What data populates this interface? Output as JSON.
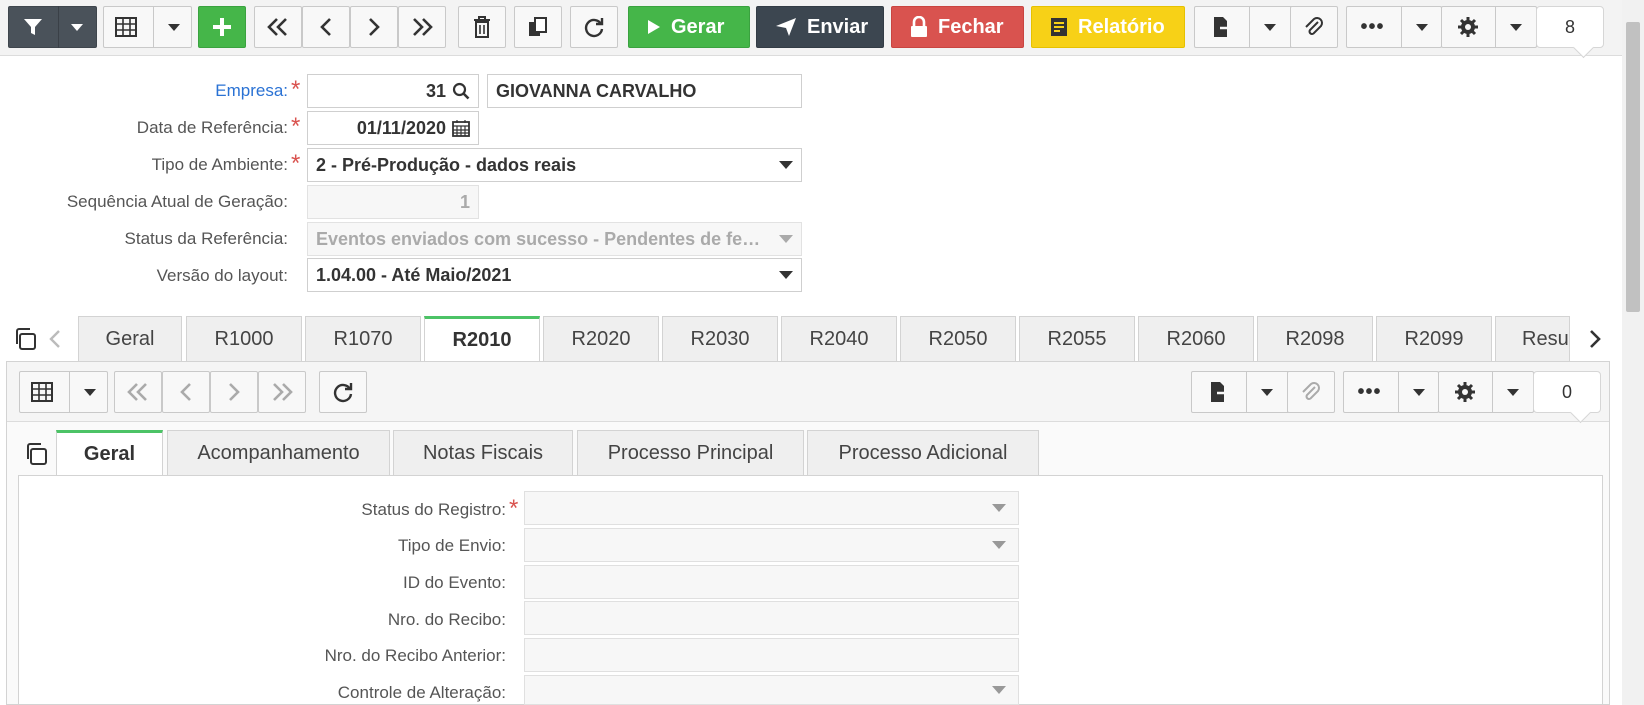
{
  "toolbar": {
    "gerar_label": "Gerar",
    "enviar_label": "Enviar",
    "fechar_label": "Fechar",
    "relatorio_label": "Relatório",
    "record_count": "8"
  },
  "form": {
    "empresa_label": "Empresa:",
    "empresa_code": "31",
    "empresa_name": "GIOVANNA CARVALHO",
    "data_ref_label": "Data de Referência:",
    "data_ref_value": "01/11/2020",
    "tipo_amb_label": "Tipo de Ambiente:",
    "tipo_amb_value": "2 - Pré-Produção - dados reais",
    "seq_label": "Sequência Atual de Geração:",
    "seq_value": "1",
    "status_ref_label": "Status da Referência:",
    "status_ref_value": "Eventos enviados com sucesso - Pendentes de fechamento",
    "versao_label": "Versão do layout:",
    "versao_value": "1.04.00 - Até Maio/2021"
  },
  "tabs": [
    "Geral",
    "R1000",
    "R1070",
    "R2010",
    "R2020",
    "R2030",
    "R2040",
    "R2050",
    "R2055",
    "R2060",
    "R2098",
    "R2099",
    "Resumo"
  ],
  "active_tab": "R2010",
  "detail_toolbar": {
    "record_count": "0"
  },
  "subtabs": [
    "Geral",
    "Acompanhamento",
    "Notas Fiscais",
    "Processo Principal",
    "Processo Adicional"
  ],
  "detail_form": {
    "status_registro_label": "Status do Registro:",
    "tipo_envio_label": "Tipo de Envio:",
    "id_evento_label": "ID do Evento:",
    "nro_recibo_label": "Nro. do Recibo:",
    "nro_recibo_ant_label": "Nro. do Recibo Anterior:",
    "controle_alt_label": "Controle de Alteração:"
  },
  "colors": {
    "accent_green": "#45b649",
    "danger": "#d9534f",
    "navy": "#3c4650",
    "warning": "#f7d117",
    "link_blue": "#2a72d4",
    "tab_active": "#4cc366"
  }
}
